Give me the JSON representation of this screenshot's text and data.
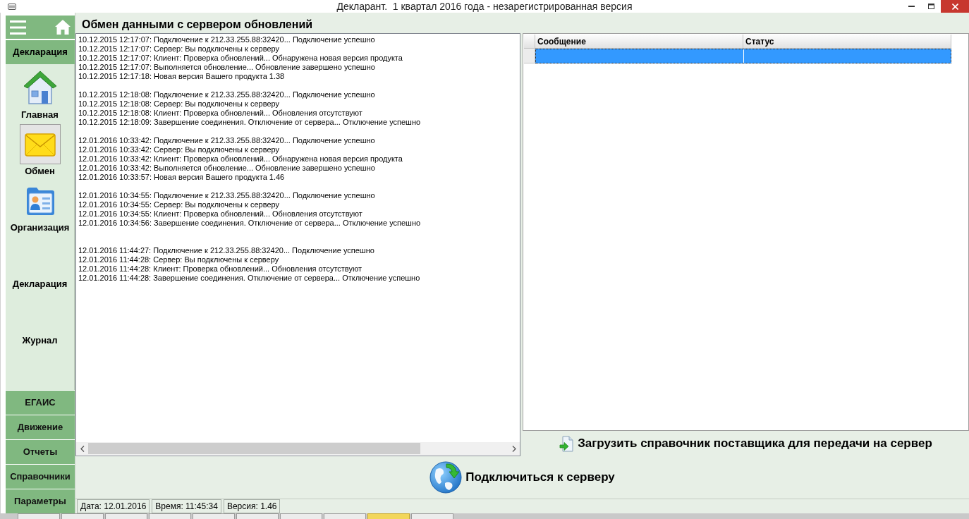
{
  "window": {
    "title": "Декларант.  1 квартал 2016 года - незарегистрированная версия"
  },
  "sidebar": {
    "section": "Декларация",
    "items": [
      {
        "label": "Главная",
        "kind": "house",
        "selected": false
      },
      {
        "label": "Обмен",
        "kind": "envelope",
        "selected": true
      },
      {
        "label": "Организация",
        "kind": "card",
        "selected": false
      },
      {
        "label": "Декларация",
        "kind": "plain",
        "selected": false
      },
      {
        "label": "Журнал",
        "kind": "plain",
        "selected": false
      }
    ],
    "sections": [
      "ЕГАИС",
      "Движение",
      "Отчеты",
      "Справочники",
      "Параметры"
    ]
  },
  "page": {
    "title": "Обмен данными с сервером обновлений"
  },
  "log": {
    "groups": [
      {
        "kind": "first",
        "lines": [
          "10.12.2015 12:17:07: Подключение к 212.33.255.88:32420... Подключение успешно",
          "10.12.2015 12:17:07: Сервер: Вы подключены к серверу",
          "10.12.2015 12:17:07: Клиент: Проверка обновлений... Обнаружена новая версия продукта",
          "10.12.2015 12:17:07: Выполняется обновление... Обновление завершено успешно",
          "10.12.2015 12:17:18: Новая версия Вашего продукта 1.38"
        ]
      },
      {
        "kind": "plain",
        "lines": [
          "10.12.2015 12:18:08: Подключение к 212.33.255.88:32420... Подключение успешно",
          "10.12.2015 12:18:08: Сервер: Вы подключены к серверу",
          "10.12.2015 12:18:08: Клиент: Проверка обновлений... Обновления отсутствуют",
          "10.12.2015 12:18:09: Завершение соединения. Отключение от сервера... Отключение успешно"
        ]
      },
      {
        "kind": "plain",
        "lines": [
          "12.01.2016 10:33:42: Подключение к 212.33.255.88:32420... Подключение успешно",
          "12.01.2016 10:33:42: Сервер: Вы подключены к серверу",
          "12.01.2016 10:33:42: Клиент: Проверка обновлений... Обнаружена новая версия продукта",
          "12.01.2016 10:33:42: Выполняется обновление... Обновление завершено успешно",
          "12.01.2016 10:33:57: Новая версия Вашего продукта 1.46"
        ]
      },
      {
        "kind": "plain",
        "lines": [
          "12.01.2016 10:34:55: Подключение к 212.33.255.88:32420... Подключение успешно",
          "12.01.2016 10:34:55: Сервер: Вы подключены к серверу",
          "12.01.2016 10:34:55: Клиент: Проверка обновлений... Обновления отсутствуют",
          "12.01.2016 10:34:56: Завершение соединения. Отключение от сервера... Отключение успешно"
        ]
      },
      {
        "kind": "spaced",
        "lines": [
          "12.01.2016 11:44:27: Подключение к 212.33.255.88:32420... Подключение успешно",
          "12.01.2016 11:44:28: Сервер: Вы подключены к серверу",
          "12.01.2016 11:44:28: Клиент: Проверка обновлений... Обновления отсутствуют",
          "12.01.2016 11:44:28: Завершение соединения. Отключение от сервера... Отключение успешно"
        ]
      }
    ]
  },
  "table": {
    "columns": [
      "Сообщение",
      "Статус"
    ],
    "rows": [
      {
        "selected": true
      }
    ]
  },
  "upload_button": "Загрузить справочник поставщика для передачи на сервер",
  "connect_button": "Подключиться к серверу",
  "status_bar": [
    "Дата: 12.01.2016",
    "Время: 11:45:34",
    "Версия: 1.46"
  ],
  "taskbar": {
    "items": [
      {
        "selected": false
      },
      {
        "selected": false
      },
      {
        "selected": false
      },
      {
        "selected": false
      },
      {
        "selected": false
      },
      {
        "selected": false
      },
      {
        "selected": false
      },
      {
        "selected": false
      },
      {
        "selected": true
      },
      {
        "selected": false
      }
    ]
  }
}
